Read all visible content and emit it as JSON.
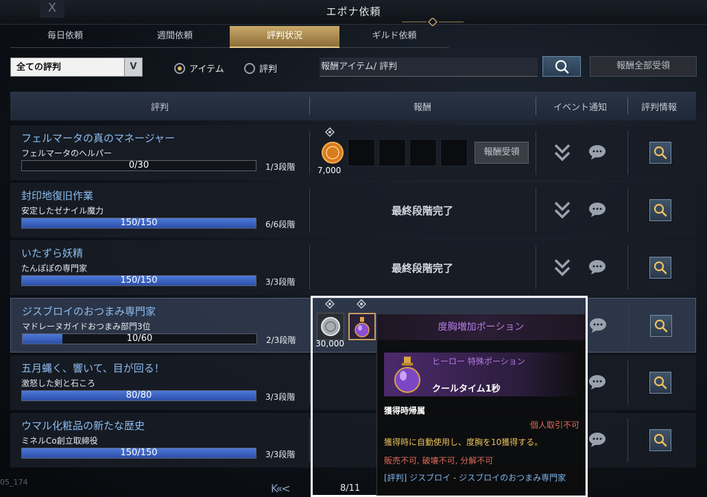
{
  "window": {
    "title": "エポナ依頼",
    "close_label": "X"
  },
  "tabs": [
    {
      "label": "毎日依頼",
      "active": false
    },
    {
      "label": "週間依頼",
      "active": false
    },
    {
      "label": "評判状況",
      "active": true
    },
    {
      "label": "ギルド依頼",
      "active": false
    }
  ],
  "filter": {
    "selected": "全ての評判",
    "arrow": "V"
  },
  "radio": {
    "item_label": "アイテム",
    "rep_label": "評判",
    "selected": "アイテム"
  },
  "search": {
    "placeholder": "報酬アイテム/ 評判"
  },
  "claim_all_label": "報酬全部受領",
  "columns": {
    "rep": "評判",
    "reward": "報酬",
    "event": "イベント通知",
    "info": "評判情報"
  },
  "rows": [
    {
      "name": "フェルマータの真のマネージャー",
      "sub": "フェルマータのヘルパー",
      "progress": "0/30",
      "fill": 0.0,
      "stage": "1/3段階",
      "reward_type": "item",
      "reward_qty": "7,000",
      "claim_label": "報酬受領"
    },
    {
      "name": "封印地復旧作業",
      "sub": "安定したゼナイル魔力",
      "progress": "150/150",
      "fill": 1.0,
      "stage": "6/6段階",
      "reward_type": "done",
      "done_label": "最終段階完了"
    },
    {
      "name": "いたずら妖精",
      "sub": "たんぽぽの専門家",
      "progress": "150/150",
      "fill": 1.0,
      "stage": "3/3段階",
      "reward_type": "done",
      "done_label": "最終段階完了"
    },
    {
      "name": "ジスブロイのおつまみ専門家",
      "sub": "マドレーヌガイドおつまみ部門3位",
      "progress": "10/60",
      "fill": 0.17,
      "stage": "2/3段階",
      "reward_type": "item",
      "reward_qty": "30,000"
    },
    {
      "name": "五月蝿く、響いて、目が回る！",
      "sub": "激怒した剣と石ころ",
      "progress": "80/80",
      "fill": 1.0,
      "stage": "3/3段階"
    },
    {
      "name": "ウマル化粧品の新たな歴史",
      "sub": "ミネルCo創立取締役",
      "progress": "150/150",
      "fill": 1.0,
      "stage": "3/3段階"
    }
  ],
  "tooltip": {
    "title": "度胸増加ポーション",
    "grade": "ヒーロー 特殊ポーション",
    "cooldown": "クールタイム1秒",
    "bound": "獲得時帰属",
    "no_trade": "個人取引不可",
    "desc": "獲得時に自動使用し、度胸を10獲得する。",
    "restrict": "販売不可, 破壊不可, 分解不可",
    "source": "[評判] ジスブロイ - ジスブロイのおつまみ専門家"
  },
  "pager": {
    "arrows": "K«<",
    "page": "8/11"
  },
  "corner_code": "05_174",
  "colors": {
    "accent_gold": "#c9a96a",
    "progress_blue": "#3d64c4",
    "hero_purple": "#b47be6",
    "warning_red": "#e06a5a"
  }
}
